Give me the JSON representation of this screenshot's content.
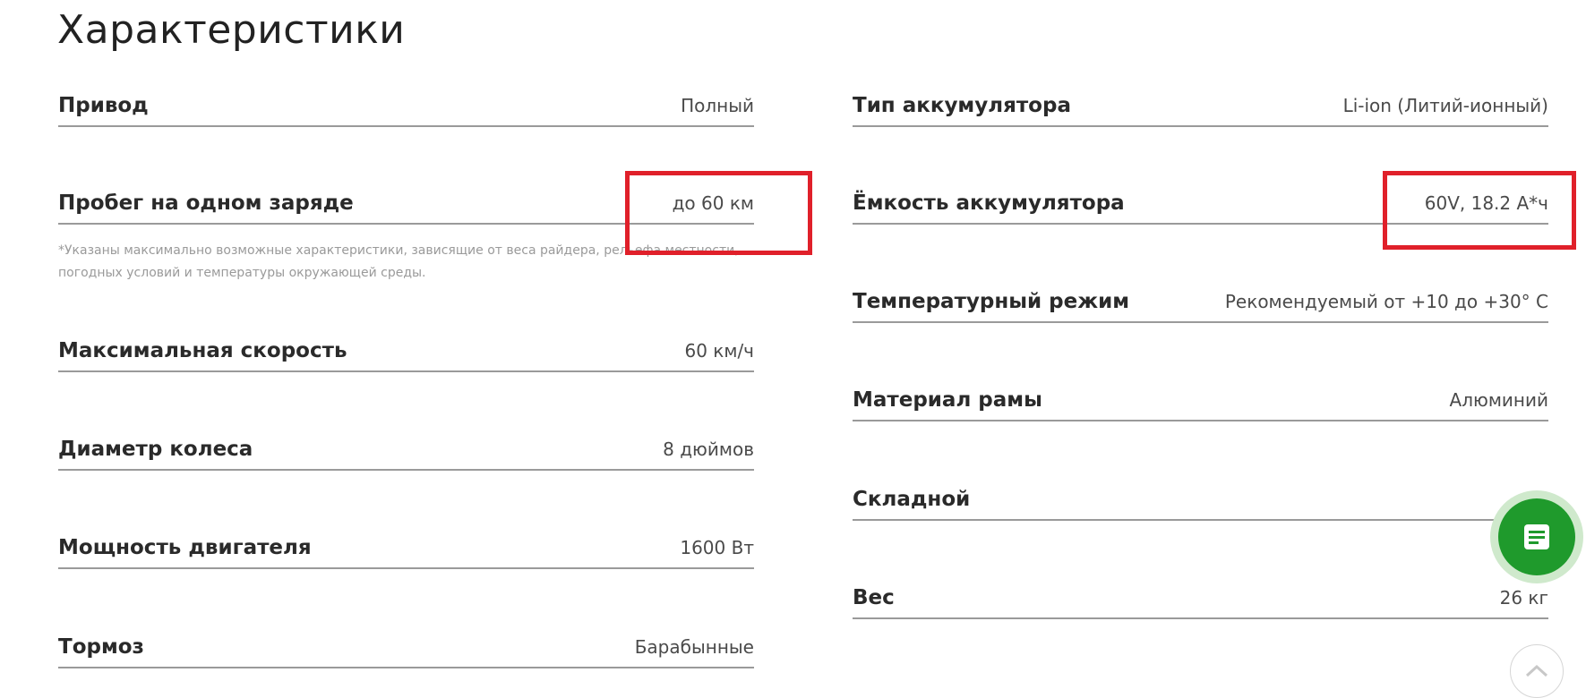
{
  "page_title": "Характеристики",
  "footnote": "*Указаны максимально возможные характеристики, зависящие от веса райдера, рельефа местности, погодных условий и температуры окружающей среды.",
  "left_specs": [
    {
      "label": "Привод",
      "value": "Полный"
    },
    {
      "label": "Пробег на одном заряде",
      "value": "до 60 км"
    },
    {
      "label": "Максимальная скорость",
      "value": "60 км/ч"
    },
    {
      "label": "Диаметр колеса",
      "value": "8 дюймов"
    },
    {
      "label": "Мощность двигателя",
      "value": "1600 Вт"
    },
    {
      "label": "Тормоз",
      "value": "Барабынные"
    }
  ],
  "right_specs": [
    {
      "label": "Тип аккумулятора",
      "value": "Li-ion (Литий-ионный)"
    },
    {
      "label": "Ёмкость аккумулятора",
      "value": "60V, 18.2 А*ч"
    },
    {
      "label": "Температурный режим",
      "value": "Рекомендуемый от +10 до +30° С"
    },
    {
      "label": "Материал рамы",
      "value": "Алюминий"
    },
    {
      "label": "Складной",
      "value": ""
    },
    {
      "label": "Вес",
      "value": "26 кг"
    }
  ],
  "icons": {
    "chat": "document-lines-icon",
    "scroll_top": "chevron-up-icon"
  },
  "colors": {
    "accent_green": "#1f9a2c",
    "highlight_red": "#e0202a",
    "divider": "#9a9a9a"
  }
}
